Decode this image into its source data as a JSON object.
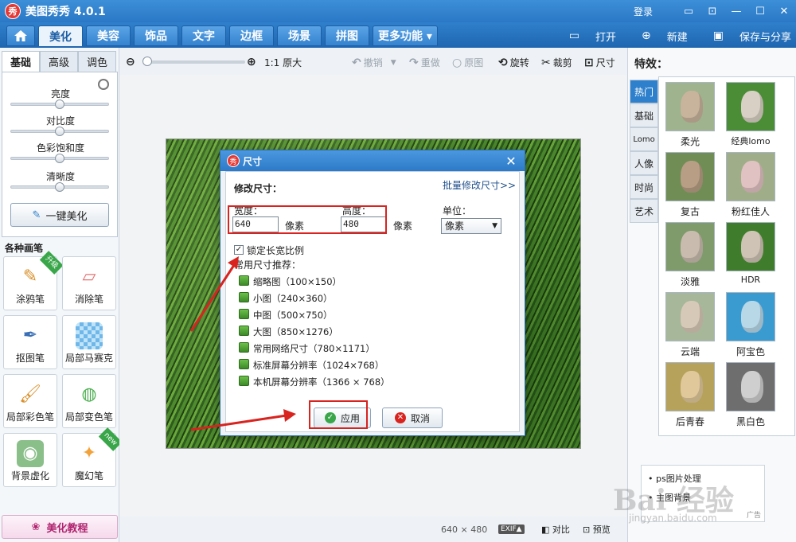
{
  "app": {
    "title": "美图秀秀 4.0.1",
    "logo": "秀",
    "login": "登录"
  },
  "window_buttons": {
    "feedback": "▭",
    "menu": "⊡",
    "minimize": "—",
    "maximize": "☐",
    "close": "✕"
  },
  "tabs": [
    "美化",
    "美容",
    "饰品",
    "文字",
    "边框",
    "场景",
    "拼图",
    "更多功能 ▾"
  ],
  "menu_actions": {
    "open": "打开",
    "new": "新建",
    "save_share": "保存与分享"
  },
  "left": {
    "subtabs": [
      "基础",
      "高级",
      "调色"
    ],
    "sliders": [
      {
        "label": "亮度",
        "value": 0.5
      },
      {
        "label": "对比度",
        "value": 0.5
      },
      {
        "label": "色彩饱和度",
        "value": 0.5
      },
      {
        "label": "清晰度",
        "value": 0.5
      }
    ],
    "one_click": "一键美化",
    "brushes_title": "各种画笔",
    "brushes": [
      {
        "label": "涂鸦笔",
        "badge": "升级"
      },
      {
        "label": "消除笔",
        "badge": ""
      },
      {
        "label": "抠图笔",
        "badge": ""
      },
      {
        "label": "局部马赛克",
        "badge": ""
      },
      {
        "label": "局部彩色笔",
        "badge": ""
      },
      {
        "label": "局部变色笔",
        "badge": ""
      },
      {
        "label": "背景虚化",
        "badge": ""
      },
      {
        "label": "魔幻笔",
        "badge": "new"
      }
    ],
    "tutorial": "美化教程"
  },
  "toolbar": {
    "zoom_level": 0,
    "actual_size": "1:1 原大",
    "undo": "撤销",
    "redo": "重做",
    "original": "原图",
    "rotate": "旋转",
    "crop": "裁剪",
    "size": "尺寸"
  },
  "status": {
    "dimensions": "640 × 480",
    "exif": "EXIF▲",
    "compare": "对比",
    "preview": "预览"
  },
  "right": {
    "title": "特效：",
    "vtabs": [
      "热门",
      "基础",
      "Lomo",
      "人像",
      "时尚",
      "艺术"
    ],
    "effects": [
      "柔光",
      "经典lomo",
      "复古",
      "粉红佳人",
      "淡雅",
      "HDR",
      "云端",
      "阿宝色",
      "后青春",
      "黑白色"
    ],
    "ad_items": [
      "ps图片处理",
      "主图背景"
    ],
    "ad_label": "广告"
  },
  "dialog": {
    "title": "尺寸",
    "section": "修改尺寸：",
    "batch_link": "批量修改尺寸>>",
    "width_label": "宽度：",
    "height_label": "高度：",
    "width_value": "640",
    "height_value": "480",
    "unit_px": "像素",
    "unit_label": "单位：",
    "unit_value": "像素",
    "lock_ratio": "锁定长宽比例",
    "presets_title": "常用尺寸推荐：",
    "presets": [
      "缩略图（100×150）",
      "小图（240×360）",
      "中图（500×750）",
      "大图（850×1276）",
      "常用网络尺寸（780×1171）",
      "标准屏幕分辨率（1024×768）",
      "本机屏幕分辨率（1366 × 768）"
    ],
    "apply": "应用",
    "cancel": "取消"
  },
  "colors": {
    "accent": "#2f80cc",
    "highlight": "#d8231f"
  },
  "watermark": {
    "brand": "Bai 经验",
    "url": "jingyan.baidu.com"
  }
}
